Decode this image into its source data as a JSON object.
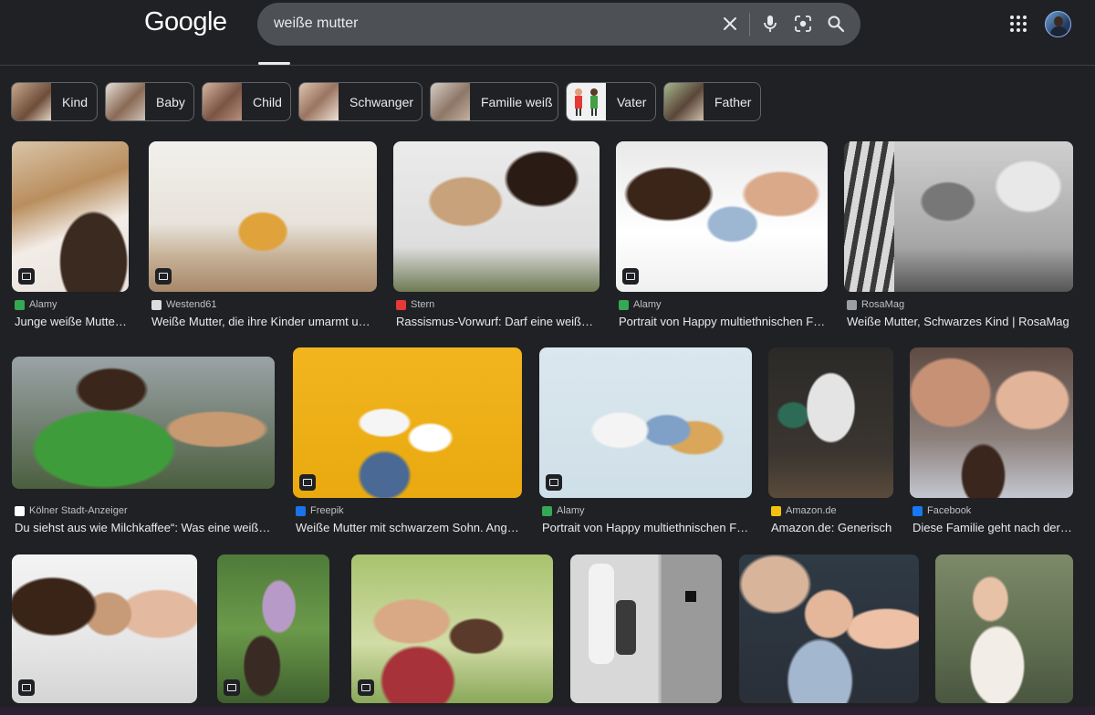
{
  "header": {
    "logo": "Google",
    "search_value": "weiße mutter",
    "icons": [
      "close-icon",
      "microphone-icon",
      "lens-icon",
      "search-icon",
      "apps-grid-icon"
    ]
  },
  "colors": {
    "background": "#202124",
    "search_bg": "#4d5156",
    "chip_border": "#5f6368",
    "text": "#e8eaed",
    "muted": "#bdc1c6"
  },
  "chips": [
    {
      "label": "Kind"
    },
    {
      "label": "Baby"
    },
    {
      "label": "Child"
    },
    {
      "label": "Schwanger"
    },
    {
      "label": "Familie weiß"
    },
    {
      "label": "Vater"
    },
    {
      "label": "Father"
    }
  ],
  "results": [
    {
      "source": "Alamy",
      "title": "Junge weiße Mutter mit Baby"
    },
    {
      "source": "Westend61",
      "title": "Weiße Mutter, die ihre Kinder umarmt und liest"
    },
    {
      "source": "Stern",
      "title": "Rassismus-Vorwurf: Darf eine weiße Mutter"
    },
    {
      "source": "Alamy",
      "title": "Portrait von Happy multiethnischen Familie"
    },
    {
      "source": "RosaMag",
      "title": "Weiße Mutter, Schwarzes Kind | RosaMag"
    },
    {
      "source": "Kölner Stadt-Anzeiger",
      "title": "Du siehst aus wie Milchkaffee“: Was eine weiße Mutter"
    },
    {
      "source": "Freepik",
      "title": "Weiße Mutter mit schwarzem Sohn. Angebot"
    },
    {
      "source": "Alamy",
      "title": "Portrait von Happy multiethnischen Familie"
    },
    {
      "source": "Amazon.de",
      "title": "Amazon.de: Generisch"
    },
    {
      "source": "Facebook",
      "title": "Diese Familie geht nach der Geburt"
    },
    {
      "source": "",
      "title": ""
    },
    {
      "source": "",
      "title": ""
    },
    {
      "source": "",
      "title": ""
    },
    {
      "source": "",
      "title": ""
    },
    {
      "source": "",
      "title": ""
    },
    {
      "source": "",
      "title": ""
    }
  ]
}
